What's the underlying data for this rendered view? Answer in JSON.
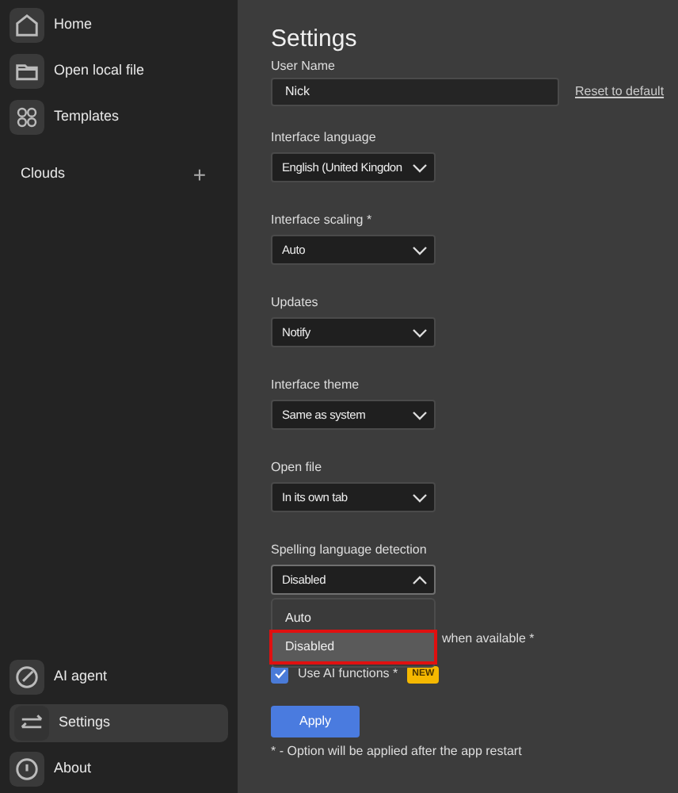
{
  "sidebar": {
    "items": [
      {
        "kind": "home",
        "label": "Home",
        "selected": false
      },
      {
        "kind": "file",
        "label": "Open local file",
        "selected": false
      },
      {
        "kind": "templates",
        "label": "Templates",
        "selected": false
      }
    ],
    "clouds": {
      "label": "Clouds",
      "add": "+"
    },
    "bottom_items": [
      {
        "kind": "ai",
        "label": "AI agent",
        "selected": false
      },
      {
        "kind": "settings",
        "label": "Settings",
        "selected": true
      },
      {
        "kind": "about",
        "label": "About",
        "selected": false
      }
    ]
  },
  "title": "Settings",
  "user_name": {
    "label": "User Name",
    "value": "Nick",
    "reset": "Reset to default"
  },
  "selects": [
    {
      "label": "Interface language",
      "value": "English (United Kingdon",
      "expanded": false
    },
    {
      "label": "Interface scaling *",
      "value": "Auto",
      "expanded": false
    },
    {
      "label": "Updates",
      "value": "Notify",
      "expanded": false
    },
    {
      "label": "Interface theme",
      "value": "Same as system",
      "expanded": false
    },
    {
      "label": "Open file",
      "value": "In its own tab",
      "expanded": false
    },
    {
      "label": "Spelling language detection",
      "value": "Disabled",
      "expanded": true
    }
  ],
  "dropdown_options": [
    {
      "label": "Auto",
      "selected": false
    },
    {
      "label": "Disabled",
      "selected": true
    }
  ],
  "checkboxes": [
    {
      "label": "when available *"
    },
    {
      "label": "Use AI functions *",
      "checked": true,
      "badge": "NEW"
    }
  ],
  "apply": "Apply",
  "footnote": "* - Option will be applied after the app restart"
}
